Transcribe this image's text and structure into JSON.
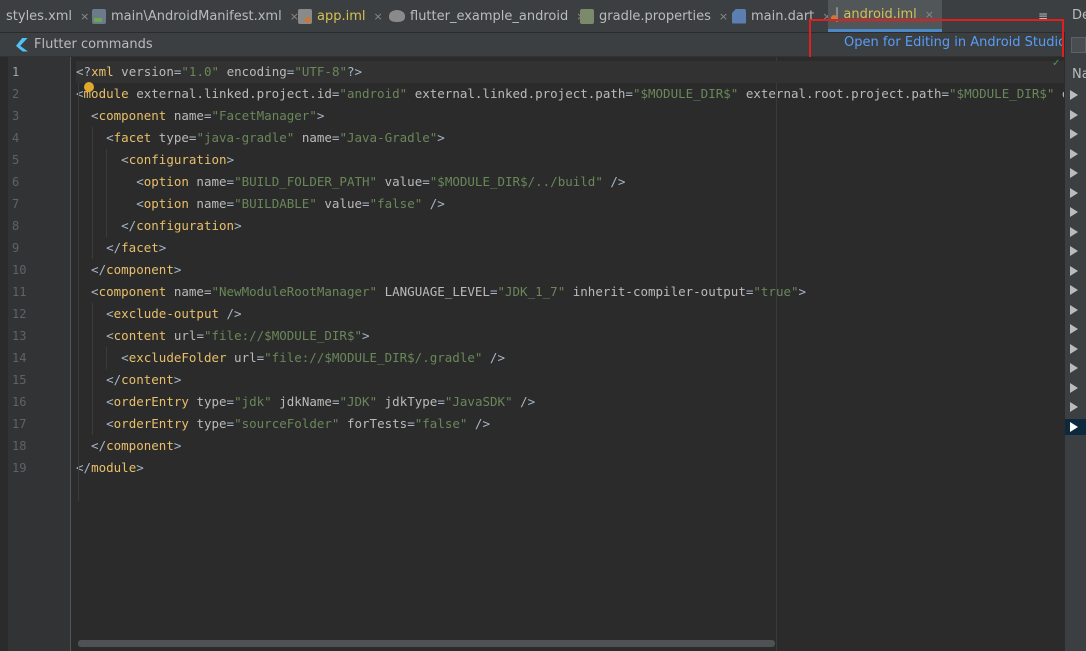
{
  "tabs": [
    {
      "label": "styles.xml",
      "icon": "xml-file-icon",
      "close": "×"
    },
    {
      "label": "main\\AndroidManifest.xml",
      "icon": "manifest-file-icon",
      "close": "×"
    },
    {
      "label": "app.iml",
      "icon": "iml-file-icon",
      "close": "×"
    },
    {
      "label": "flutter_example_android",
      "icon": "gradle-elephant-icon",
      "close": "×"
    },
    {
      "label": "gradle.properties",
      "icon": "properties-file-icon",
      "close": "×"
    },
    {
      "label": "main.dart",
      "icon": "dart-file-icon",
      "close": "×"
    },
    {
      "label": "android.iml",
      "icon": "iml-file-icon",
      "close": "×"
    }
  ],
  "tab_overflow": "≡",
  "right_panel": {
    "top_label": "De",
    "label": "Na"
  },
  "notification": {
    "flutter_commands": "Flutter commands",
    "open_link": "Open for Editing in Android Studio"
  },
  "line_numbers": [
    "1",
    "2",
    "3",
    "4",
    "5",
    "6",
    "7",
    "8",
    "9",
    "10",
    "11",
    "12",
    "13",
    "14",
    "15",
    "16",
    "17",
    "18",
    "19"
  ],
  "code_lines": [
    [
      [
        "p",
        "<?"
      ],
      [
        "t",
        "xml "
      ],
      [
        "a",
        "version"
      ],
      [
        "p",
        "="
      ],
      [
        "v",
        "\"1.0\""
      ],
      [
        "p",
        " "
      ],
      [
        "a",
        "encoding"
      ],
      [
        "p",
        "="
      ],
      [
        "v",
        "\"UTF-8\""
      ],
      [
        "p",
        "?>"
      ]
    ],
    [
      [
        "p",
        "<"
      ],
      [
        "t",
        "module "
      ],
      [
        "a",
        "external.linked.project.id"
      ],
      [
        "p",
        "="
      ],
      [
        "v",
        "\"android\""
      ],
      [
        "p",
        " "
      ],
      [
        "a",
        "external.linked.project.path"
      ],
      [
        "p",
        "="
      ],
      [
        "v",
        "\"$MODULE_DIR$\""
      ],
      [
        "p",
        " "
      ],
      [
        "a",
        "external.root.project.path"
      ],
      [
        "p",
        "="
      ],
      [
        "v",
        "\"$MODULE_DIR$\""
      ],
      [
        "p",
        " "
      ],
      [
        "a",
        "external.s"
      ]
    ],
    [
      [
        "p",
        "  <"
      ],
      [
        "t",
        "component "
      ],
      [
        "a",
        "name"
      ],
      [
        "p",
        "="
      ],
      [
        "v",
        "\"FacetManager\""
      ],
      [
        "p",
        ">"
      ]
    ],
    [
      [
        "p",
        "    <"
      ],
      [
        "t",
        "facet "
      ],
      [
        "a",
        "type"
      ],
      [
        "p",
        "="
      ],
      [
        "v",
        "\"java-gradle\""
      ],
      [
        "p",
        " "
      ],
      [
        "a",
        "name"
      ],
      [
        "p",
        "="
      ],
      [
        "v",
        "\"Java-Gradle\""
      ],
      [
        "p",
        ">"
      ]
    ],
    [
      [
        "p",
        "      <"
      ],
      [
        "t",
        "configuration"
      ],
      [
        "p",
        ">"
      ]
    ],
    [
      [
        "p",
        "        <"
      ],
      [
        "t",
        "option "
      ],
      [
        "a",
        "name"
      ],
      [
        "p",
        "="
      ],
      [
        "v",
        "\"BUILD_FOLDER_PATH\""
      ],
      [
        "p",
        " "
      ],
      [
        "a",
        "value"
      ],
      [
        "p",
        "="
      ],
      [
        "v",
        "\"$MODULE_DIR$/../build\""
      ],
      [
        "p",
        " />"
      ]
    ],
    [
      [
        "p",
        "        <"
      ],
      [
        "t",
        "option "
      ],
      [
        "a",
        "name"
      ],
      [
        "p",
        "="
      ],
      [
        "v",
        "\"BUILDABLE\""
      ],
      [
        "p",
        " "
      ],
      [
        "a",
        "value"
      ],
      [
        "p",
        "="
      ],
      [
        "v",
        "\"false\""
      ],
      [
        "p",
        " />"
      ]
    ],
    [
      [
        "p",
        "      </"
      ],
      [
        "t",
        "configuration"
      ],
      [
        "p",
        ">"
      ]
    ],
    [
      [
        "p",
        "    </"
      ],
      [
        "t",
        "facet"
      ],
      [
        "p",
        ">"
      ]
    ],
    [
      [
        "p",
        "  </"
      ],
      [
        "t",
        "component"
      ],
      [
        "p",
        ">"
      ]
    ],
    [
      [
        "p",
        "  <"
      ],
      [
        "t",
        "component "
      ],
      [
        "a",
        "name"
      ],
      [
        "p",
        "="
      ],
      [
        "v",
        "\"NewModuleRootManager\""
      ],
      [
        "p",
        " "
      ],
      [
        "a",
        "LANGUAGE_LEVEL"
      ],
      [
        "p",
        "="
      ],
      [
        "v",
        "\"JDK_1_7\""
      ],
      [
        "p",
        " "
      ],
      [
        "a",
        "inherit-compiler-output"
      ],
      [
        "p",
        "="
      ],
      [
        "v",
        "\"true\""
      ],
      [
        "p",
        ">"
      ]
    ],
    [
      [
        "p",
        "    <"
      ],
      [
        "t",
        "exclude-output "
      ],
      [
        "p",
        "/>"
      ]
    ],
    [
      [
        "p",
        "    <"
      ],
      [
        "t",
        "content "
      ],
      [
        "a",
        "url"
      ],
      [
        "p",
        "="
      ],
      [
        "v",
        "\"file://$MODULE_DIR$\""
      ],
      [
        "p",
        ">"
      ]
    ],
    [
      [
        "p",
        "      <"
      ],
      [
        "t",
        "excludeFolder "
      ],
      [
        "a",
        "url"
      ],
      [
        "p",
        "="
      ],
      [
        "v",
        "\"file://$MODULE_DIR$/.gradle\""
      ],
      [
        "p",
        " />"
      ]
    ],
    [
      [
        "p",
        "    </"
      ],
      [
        "t",
        "content"
      ],
      [
        "p",
        ">"
      ]
    ],
    [
      [
        "p",
        "    <"
      ],
      [
        "t",
        "orderEntry "
      ],
      [
        "a",
        "type"
      ],
      [
        "p",
        "="
      ],
      [
        "v",
        "\"jdk\""
      ],
      [
        "p",
        " "
      ],
      [
        "a",
        "jdkName"
      ],
      [
        "p",
        "="
      ],
      [
        "v",
        "\"JDK\""
      ],
      [
        "p",
        " "
      ],
      [
        "a",
        "jdkType"
      ],
      [
        "p",
        "="
      ],
      [
        "v",
        "\"JavaSDK\""
      ],
      [
        "p",
        " />"
      ]
    ],
    [
      [
        "p",
        "    <"
      ],
      [
        "t",
        "orderEntry "
      ],
      [
        "a",
        "type"
      ],
      [
        "p",
        "="
      ],
      [
        "v",
        "\"sourceFolder\""
      ],
      [
        "p",
        " "
      ],
      [
        "a",
        "forTests"
      ],
      [
        "p",
        "="
      ],
      [
        "v",
        "\"false\""
      ],
      [
        "p",
        " />"
      ]
    ],
    [
      [
        "p",
        "  </"
      ],
      [
        "t",
        "component"
      ],
      [
        "p",
        ">"
      ]
    ],
    [
      [
        "p",
        "</"
      ],
      [
        "t",
        "module"
      ],
      [
        "p",
        ">"
      ]
    ]
  ],
  "colors": {
    "tag": "#e8bf6a",
    "attr": "#bababa",
    "value": "#6a8759",
    "accent": "#589df6",
    "highlight_box": "#e02020"
  }
}
